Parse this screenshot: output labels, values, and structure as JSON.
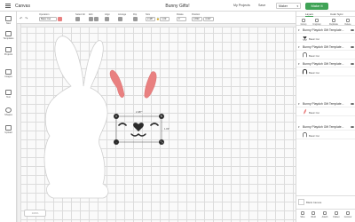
{
  "header": {
    "app_name": "Canvas",
    "project_title": "Bunny Gifts!",
    "my_projects": "My Projects",
    "save": "Save",
    "machine": "Maker",
    "make_it": "Make It"
  },
  "toolbar": {
    "operation_label": "Operation",
    "operation_value": "Basic Cut",
    "select_all": "Select All",
    "edit": "Edit",
    "align": "Align",
    "arrange": "Arrange",
    "flip": "Flip",
    "size": "Size",
    "rotate": "Rotate",
    "position": "Position",
    "w_value": "2.487",
    "h_value": "1.03",
    "rotate_value": "0",
    "x_value": "4.833",
    "y_value": "4.347"
  },
  "left_sidebar": {
    "items": [
      {
        "label": "New"
      },
      {
        "label": "Templates"
      },
      {
        "label": "Projects"
      },
      {
        "label": "Images"
      },
      {
        "label": "Text"
      },
      {
        "label": "Shapes"
      },
      {
        "label": "Upload"
      }
    ]
  },
  "canvas": {
    "zoom_label": "100%",
    "selection_width": "2.487\"",
    "selection_height": "1.03\"",
    "colors": {
      "bunny_fill": "#ffffff",
      "ear_inner": "#e98080",
      "face": "#2b2b2b"
    }
  },
  "right_panel": {
    "tabs": [
      "Layers",
      "Color Sync"
    ],
    "actions": [
      "Group",
      "Ungroup",
      "Duplicate",
      "Delete"
    ],
    "layers": [
      {
        "name": "Bunny Playdoh Gift Template...",
        "operation": "Basic Cut",
        "thumb": "bunny-face"
      },
      {
        "name": "Bunny Playdoh Gift Template...",
        "operation": "Basic Cut",
        "thumb": "arch"
      },
      {
        "name": "Bunny Playdoh Gift Template...",
        "operation": "Basic Cut",
        "thumb": "arch-dark"
      },
      {
        "name": "Bunny Playdoh Gift Template...",
        "operation": "Basic Cut",
        "thumb": "pink-ear"
      },
      {
        "name": "Bunny Playdoh Gift Template...",
        "operation": "Basic Cut",
        "thumb": "arch"
      }
    ],
    "blank_canvas": "Blank Canvas",
    "bottom_actions": [
      "Slice",
      "Weld",
      "Attach",
      "Flatten",
      "Contour"
    ]
  }
}
